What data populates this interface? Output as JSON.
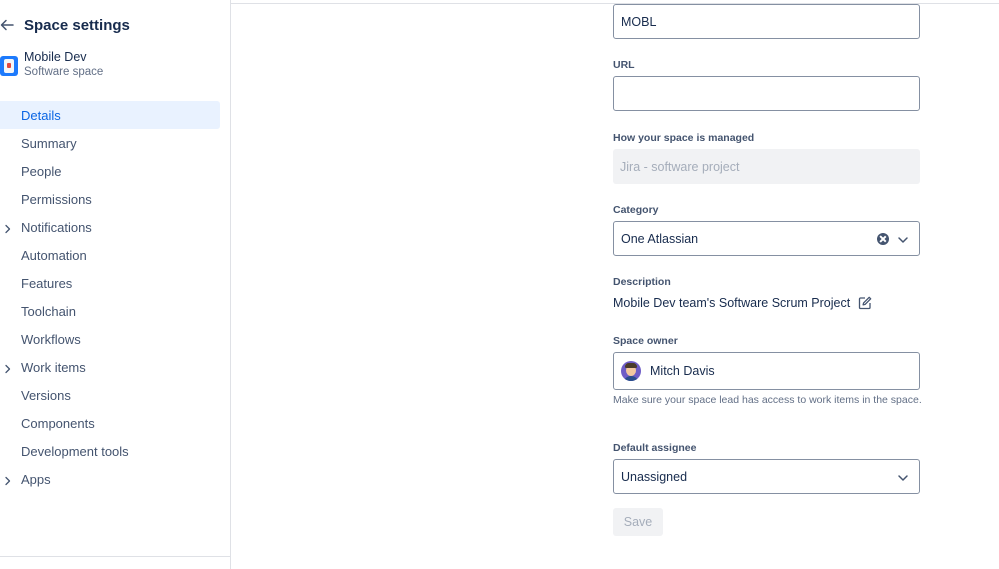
{
  "sidebar": {
    "title": "Space settings",
    "space": {
      "name": "Mobile Dev",
      "type": "Software space"
    },
    "items": [
      {
        "label": "Details",
        "active": true,
        "expandable": false
      },
      {
        "label": "Summary",
        "active": false,
        "expandable": false
      },
      {
        "label": "People",
        "active": false,
        "expandable": false
      },
      {
        "label": "Permissions",
        "active": false,
        "expandable": false
      },
      {
        "label": "Notifications",
        "active": false,
        "expandable": true
      },
      {
        "label": "Automation",
        "active": false,
        "expandable": false
      },
      {
        "label": "Features",
        "active": false,
        "expandable": false
      },
      {
        "label": "Toolchain",
        "active": false,
        "expandable": false
      },
      {
        "label": "Workflows",
        "active": false,
        "expandable": false
      },
      {
        "label": "Work items",
        "active": false,
        "expandable": true
      },
      {
        "label": "Versions",
        "active": false,
        "expandable": false
      },
      {
        "label": "Components",
        "active": false,
        "expandable": false
      },
      {
        "label": "Development tools",
        "active": false,
        "expandable": false
      },
      {
        "label": "Apps",
        "active": false,
        "expandable": true
      }
    ]
  },
  "form": {
    "key": {
      "value": "MOBL"
    },
    "url": {
      "label": "URL",
      "value": ""
    },
    "managed": {
      "label": "How your space is managed",
      "value": "Jira - software project"
    },
    "category": {
      "label": "Category",
      "value": "One Atlassian"
    },
    "description": {
      "label": "Description",
      "value": "Mobile Dev team's Software Scrum Project"
    },
    "owner": {
      "label": "Space owner",
      "value": "Mitch Davis",
      "helper": "Make sure your space lead has access to work items in the space."
    },
    "assignee": {
      "label": "Default assignee",
      "value": "Unassigned"
    },
    "save_label": "Save"
  },
  "colors": {
    "accent": "#0c66e4",
    "active_bg": "#e9f2ff",
    "text": "#172b4d",
    "subtle": "#626f86"
  }
}
